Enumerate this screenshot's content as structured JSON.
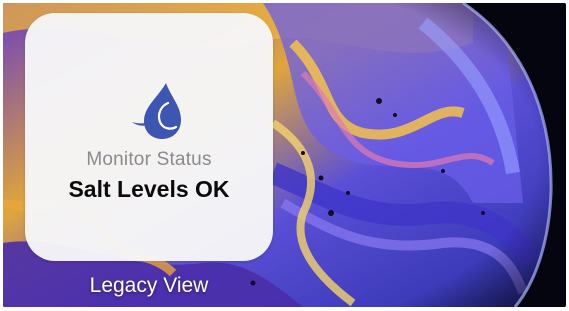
{
  "widget": {
    "caption": "Monitor Status",
    "value": "Salt Levels OK",
    "title": "Legacy View",
    "icon": "water-drop-icon"
  },
  "colors": {
    "icon_blue": "#3d55b3",
    "caption_gray": "#8a8a8e",
    "value_black": "#0b0b0c",
    "widget_background": "#f6f6f8",
    "label_white": "#ffffff"
  }
}
